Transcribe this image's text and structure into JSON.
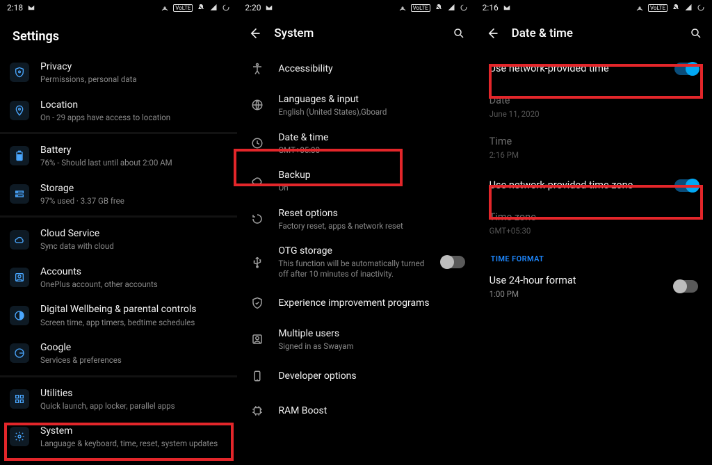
{
  "pane1": {
    "status_time": "2:18",
    "title": "Settings",
    "items": [
      {
        "label": "Privacy",
        "sub": "Permissions, personal data"
      },
      {
        "label": "Location",
        "sub": "On - 29 apps have access to location"
      },
      {
        "label": "Battery",
        "sub": "76% - Should last until about 2:00 AM"
      },
      {
        "label": "Storage",
        "sub": "97% used · 3.37 GB free"
      },
      {
        "label": "Cloud Service",
        "sub": "Sync data with cloud"
      },
      {
        "label": "Accounts",
        "sub": "OnePlus account, other accounts"
      },
      {
        "label": "Digital Wellbeing & parental controls",
        "sub": "Screen time, app timers, bedtime schedules"
      },
      {
        "label": "Google",
        "sub": "Services & preferences"
      },
      {
        "label": "Utilities",
        "sub": "Quick launch, app locker, parallel apps"
      },
      {
        "label": "System",
        "sub": "Language & keyboard, time, reset, system updates"
      }
    ]
  },
  "pane2": {
    "status_time": "2:20",
    "title": "System",
    "items": [
      {
        "label": "Accessibility",
        "sub": ""
      },
      {
        "label": "Languages & input",
        "sub": "English (United States),Gboard"
      },
      {
        "label": "Date & time",
        "sub": "GMT+05:30"
      },
      {
        "label": "Backup",
        "sub": "On"
      },
      {
        "label": "Reset options",
        "sub": "Factory reset, apps & network reset"
      },
      {
        "label": "OTG storage",
        "sub": "This function will be automatically turned off after 10 minutes of inactivity.",
        "toggle": "off"
      },
      {
        "label": "Experience improvement programs",
        "sub": ""
      },
      {
        "label": "Multiple users",
        "sub": "Signed in as  Swayam"
      },
      {
        "label": "Developer options",
        "sub": ""
      },
      {
        "label": "RAM Boost",
        "sub": ""
      }
    ]
  },
  "pane3": {
    "status_time": "2:16",
    "title": "Date & time",
    "rows": {
      "net_time": {
        "label": "Use network-provided time",
        "toggle": "on"
      },
      "date": {
        "label": "Date",
        "sub": "June 11, 2020"
      },
      "time": {
        "label": "Time",
        "sub": "2:16 PM"
      },
      "net_tz": {
        "label": "Use network-provided time zone",
        "toggle": "on"
      },
      "tz": {
        "label": "Time zone",
        "sub": "GMT+05:30"
      },
      "section": "TIME FORMAT",
      "hour24": {
        "label": "Use 24-hour format",
        "sub": "1:00 PM",
        "toggle": "off"
      }
    }
  },
  "status_icons": [
    "hotspot",
    "volte",
    "dnd",
    "signal",
    "loading"
  ]
}
